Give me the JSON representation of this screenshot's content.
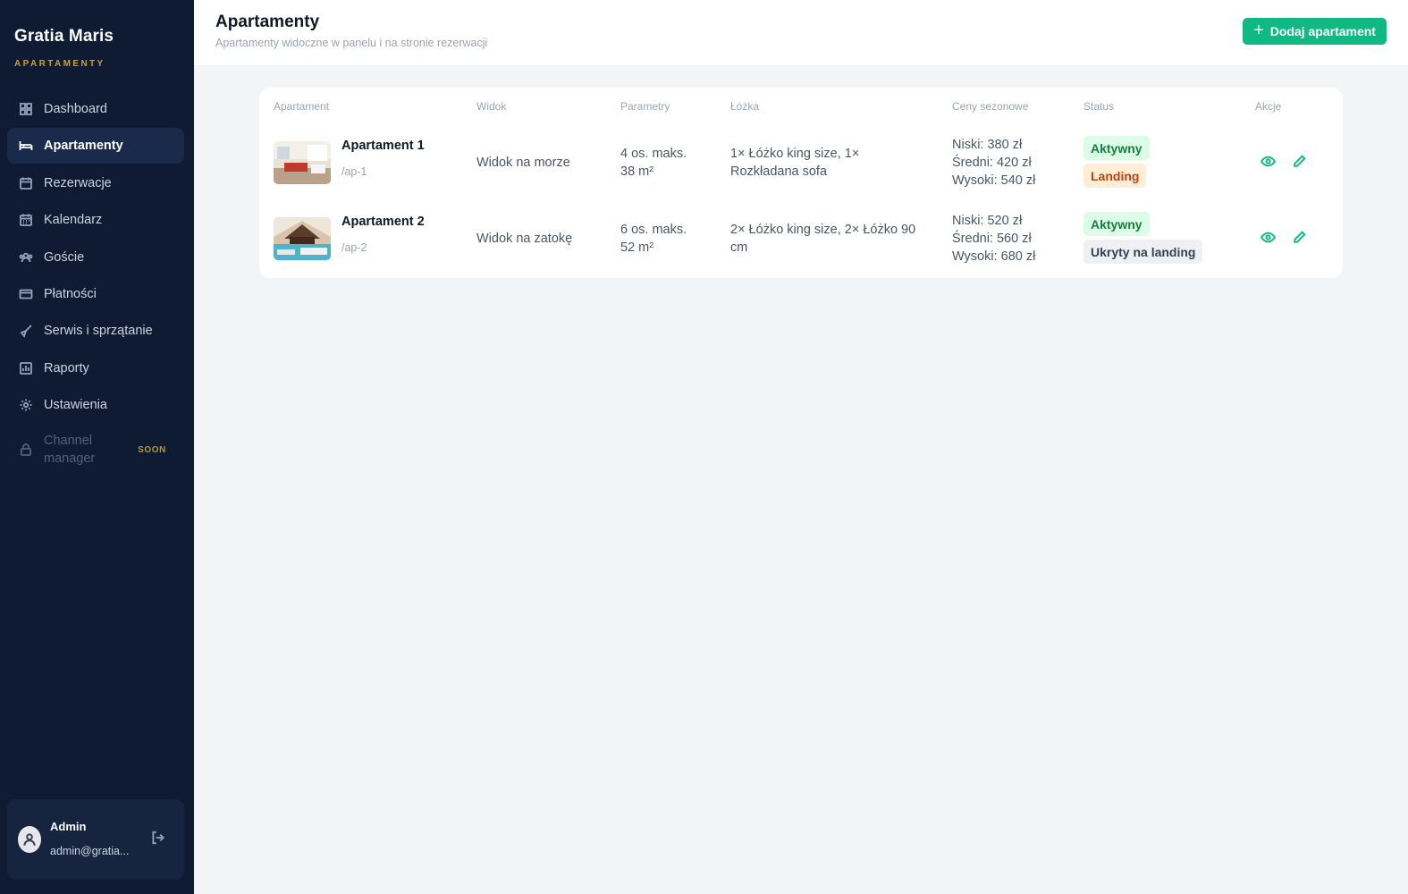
{
  "brand": {
    "name": "Gratia Maris",
    "subtitle": "APARTAMENTY"
  },
  "sidebar": {
    "items": [
      {
        "label": "Dashboard",
        "icon": "grid-icon"
      },
      {
        "label": "Apartamenty",
        "icon": "bed-icon",
        "active": true
      },
      {
        "label": "Rezerwacje",
        "icon": "calendar-check-icon"
      },
      {
        "label": "Kalendarz",
        "icon": "calendar-icon"
      },
      {
        "label": "Goście",
        "icon": "users-icon"
      },
      {
        "label": "Płatności",
        "icon": "credit-card-icon"
      },
      {
        "label": "Serwis i sprzątanie",
        "icon": "broom-icon"
      },
      {
        "label": "Raporty",
        "icon": "chart-icon"
      },
      {
        "label": "Ustawienia",
        "icon": "gear-icon"
      }
    ],
    "channel_manager": {
      "label": "Channel manager",
      "badge": "SOON",
      "icon": "lock-icon"
    }
  },
  "user": {
    "name": "Admin",
    "email": "admin@gratia..."
  },
  "header": {
    "title": "Apartamenty",
    "subtitle": "Apartamenty widoczne w panelu i na stronie rezerwacji",
    "add_button": "Dodaj apartament"
  },
  "table": {
    "columns": [
      "Apartament",
      "Widok",
      "Parametry",
      "Łóżka",
      "Ceny sezonowe",
      "Status",
      "Akcje"
    ],
    "rows": [
      {
        "name": "Apartament 1",
        "slug": "/ap-1",
        "view": "Widok na morze",
        "params_line1": "4 os. maks.",
        "params_line2": "38 m²",
        "beds_line1": "1× Łóżko king size, 1×",
        "beds_line2": "Rozkładana sofa",
        "price_low": "Niski: 380 zł",
        "price_mid": "Średni: 420 zł",
        "price_high": "Wysoki: 540 zł",
        "status": "Aktywny",
        "landing": "Landing"
      },
      {
        "name": "Apartament 2",
        "slug": "/ap-2",
        "view": "Widok na zatokę",
        "params_line1": "6 os. maks.",
        "params_line2": "52 m²",
        "beds_line1": "2× Łóżko king size, 2× Łóżko 90",
        "beds_line2": "cm",
        "price_low": "Niski: 520 zł",
        "price_mid": "Średni: 560 zł",
        "price_high": "Wysoki: 680 zł",
        "status": "Aktywny",
        "landing": "Ukryty na landing"
      }
    ]
  },
  "colors": {
    "sidebar": "#0f1b33",
    "accent": "#10b981",
    "brand_gold": "#d4a017"
  }
}
